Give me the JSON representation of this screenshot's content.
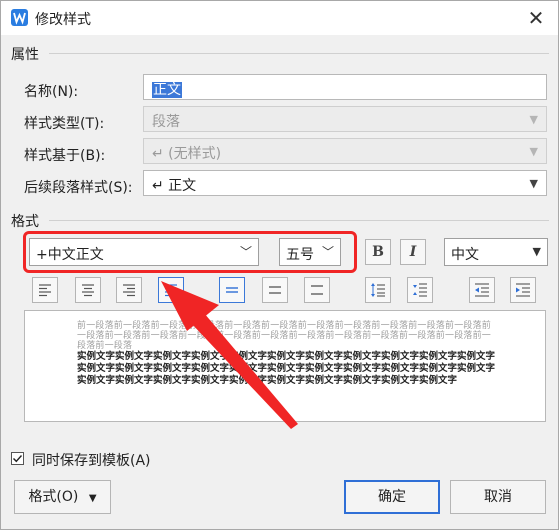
{
  "window": {
    "title": "修改样式",
    "close_glyph": "✕"
  },
  "properties": {
    "section_label": "属性",
    "name": {
      "label": "名称(N):",
      "value": "正文"
    },
    "style_type": {
      "label": "样式类型(T):",
      "value": "段落"
    },
    "based_on": {
      "label": "样式基于(B):",
      "value": "↵ (无样式)"
    },
    "next_style": {
      "label": "后续段落样式(S):",
      "value": "↵ 正文"
    }
  },
  "format": {
    "section_label": "格式",
    "font": "+中文正文",
    "size": "五号",
    "bold": "B",
    "italic": "I",
    "language": "中文"
  },
  "preview": {
    "previous_paragraph": "前一段落前一段落前一段落前一段落前一段落前一段落前一段落前一段落前一段落前一段落前一段落前一段落前一段落前一段落前一段落前一段落前一段落前一段落前一段落前一段落前一段落前一段落前一段落前一段落",
    "sample_text": "实例文字实例文字实例文字实例文字实例文字实例文字实例文字实例文字实例文字实例文字实例文字实例文字实例文字实例文字实例文字实例文字实例文字实例文字实例文字实例文字实例文字实例文字实例文字实例文字实例文字实例文字实例文字实例文字实例文字实例文字实例文字实例文字"
  },
  "save_to_template": {
    "label": "同时保存到模板(A)",
    "checked": true
  },
  "buttons": {
    "format": "格式(O)",
    "format_arrow": "▼",
    "ok": "确定",
    "cancel": "取消"
  },
  "colors": {
    "accent": "#2f6fd6",
    "highlight": "#f02525",
    "selection": "#3c78d8"
  },
  "icons": [
    "app-icon",
    "close-icon",
    "chevron-down-icon",
    "bold-icon",
    "italic-icon",
    "align-left-icon",
    "align-center-icon",
    "align-right-icon",
    "align-justify-icon",
    "line-spacing-single-icon",
    "line-spacing-1-5-icon",
    "line-spacing-double-icon",
    "paragraph-spacing-increase-icon",
    "paragraph-spacing-decrease-icon",
    "indent-decrease-icon",
    "indent-increase-icon",
    "check-icon",
    "red-arrow-annotation"
  ]
}
